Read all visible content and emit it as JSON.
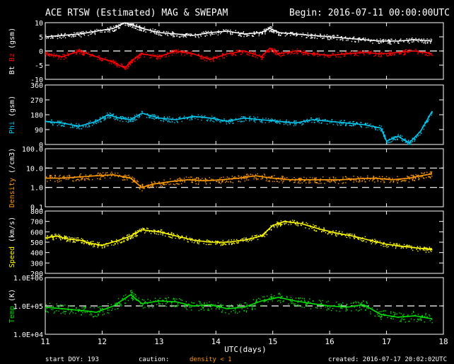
{
  "chart_data": {
    "type": "line",
    "title": "ACE RTSW (Estimated) MAG & SWEPAM",
    "begin_label": "Begin: 2016-07-11 00:00:00UTC",
    "xlabel": "UTC(days)",
    "x_ticks": [
      "11",
      "12",
      "13",
      "14",
      "15",
      "16",
      "17",
      "18"
    ],
    "xlim": [
      11,
      18
    ],
    "footer": {
      "start_doy": "start DOY: 193",
      "caution": "caution:",
      "density_note": "density < 1",
      "created": "created: 2016-07-17 20:02:02UTC"
    },
    "colors": {
      "bt": "#ffffff",
      "bz": "#ff0000",
      "phi": "#00c8f0",
      "density": "#ff9900",
      "speed": "#ffff00",
      "temp": "#00e000",
      "axes": "#ffffff"
    },
    "panels": [
      {
        "id": "mag",
        "ylabel_parts": [
          {
            "text": "Bt",
            "color": "#ffffff"
          },
          {
            "text": " Bz",
            "color": "#ff0000"
          },
          {
            "text": " (gsm)",
            "color": "#ffffff"
          }
        ],
        "ylim": [
          -10,
          10
        ],
        "scale": "linear",
        "yticks": [
          "10",
          "5",
          "0",
          "-5",
          "-10"
        ],
        "ytick_values": [
          10,
          5,
          0,
          -5,
          -10
        ],
        "ref_lines": [
          0
        ],
        "series": [
          {
            "name": "Bt",
            "color": "#ffffff",
            "x": [
              11.0,
              11.3,
              11.6,
              11.9,
              12.2,
              12.4,
              12.55,
              12.7,
              13.0,
              13.3,
              13.6,
              13.9,
              14.2,
              14.5,
              14.8,
              14.95,
              15.1,
              15.4,
              15.7,
              16.0,
              16.3,
              16.6,
              16.9,
              17.2,
              17.5,
              17.8
            ],
            "y": [
              5,
              5.5,
              6,
              7,
              8,
              10,
              9,
              8,
              6.5,
              6,
              5.5,
              6.5,
              7,
              6,
              6.5,
              8,
              6.5,
              6,
              5.5,
              5,
              4.5,
              4,
              3.5,
              3.5,
              4,
              3.5
            ]
          },
          {
            "name": "Bz",
            "color": "#ff0000",
            "x": [
              11.0,
              11.3,
              11.6,
              11.9,
              12.2,
              12.4,
              12.55,
              12.7,
              13.0,
              13.3,
              13.6,
              13.9,
              14.2,
              14.5,
              14.8,
              14.95,
              15.1,
              15.4,
              15.7,
              16.0,
              16.3,
              16.6,
              16.9,
              17.2,
              17.5,
              17.8
            ],
            "y": [
              -1,
              -2,
              0,
              -2,
              -4,
              -6,
              -3,
              -1,
              -2,
              0,
              -1,
              -3,
              -1,
              0,
              -2,
              1,
              -1,
              0,
              -1,
              -1.5,
              -1,
              -0.5,
              -1,
              -0.5,
              0,
              -1
            ]
          }
        ]
      },
      {
        "id": "phi",
        "ylabel_parts": [
          {
            "text": "Phi",
            "color": "#00c8f0"
          },
          {
            "text": " (gsm)",
            "color": "#ffffff"
          }
        ],
        "ylim": [
          0,
          360
        ],
        "scale": "linear",
        "yticks": [
          "360",
          "270",
          "180",
          "90",
          "0"
        ],
        "ytick_values": [
          360,
          270,
          180,
          90,
          0
        ],
        "ref_lines": [],
        "series": [
          {
            "name": "Phi",
            "color": "#00c8f0",
            "x": [
              11.0,
              11.3,
              11.6,
              11.9,
              12.1,
              12.3,
              12.5,
              12.7,
              13.0,
              13.3,
              13.6,
              13.9,
              14.2,
              14.5,
              14.8,
              15.1,
              15.4,
              15.7,
              16.0,
              16.3,
              16.6,
              16.9,
              17.0,
              17.2,
              17.4,
              17.6,
              17.8
            ],
            "y": [
              140,
              130,
              110,
              140,
              180,
              160,
              150,
              190,
              160,
              150,
              170,
              160,
              140,
              160,
              150,
              140,
              130,
              150,
              140,
              130,
              120,
              100,
              20,
              50,
              10,
              80,
              200
            ]
          }
        ]
      },
      {
        "id": "density",
        "ylabel_parts": [
          {
            "text": "Density",
            "color": "#ff9900"
          },
          {
            "text": " (/cm3)",
            "color": "#ffffff"
          }
        ],
        "ylim": [
          0.1,
          100
        ],
        "scale": "log",
        "yticks": [
          "100.0",
          "10.0",
          "1.0",
          "0.1"
        ],
        "ytick_values": [
          100,
          10,
          1,
          0.1
        ],
        "ref_lines": [
          10,
          1
        ],
        "series": [
          {
            "name": "Density",
            "color": "#ff9900",
            "x": [
              11.0,
              11.3,
              11.6,
              11.9,
              12.2,
              12.5,
              12.7,
              12.9,
              13.2,
              13.5,
              13.8,
              14.1,
              14.4,
              14.7,
              15.0,
              15.3,
              15.6,
              15.9,
              16.2,
              16.5,
              16.8,
              17.1,
              17.4,
              17.6,
              17.8
            ],
            "y": [
              3,
              3,
              3.5,
              4,
              4.5,
              3,
              1,
              1.5,
              2,
              2.5,
              2.2,
              2.5,
              3,
              4,
              3,
              2.5,
              2.5,
              2.5,
              2.5,
              2.8,
              3,
              2.5,
              3,
              4,
              5
            ]
          }
        ]
      },
      {
        "id": "speed",
        "ylabel_parts": [
          {
            "text": "Speed",
            "color": "#ffff00"
          },
          {
            "text": " (km/s)",
            "color": "#ffffff"
          }
        ],
        "ylim": [
          200,
          800
        ],
        "scale": "linear",
        "yticks": [
          "800",
          "700",
          "600",
          "500",
          "400",
          "300",
          "200"
        ],
        "ytick_values": [
          800,
          700,
          600,
          500,
          400,
          300,
          200
        ],
        "ref_lines": [],
        "series": [
          {
            "name": "Speed",
            "color": "#ffff00",
            "x": [
              11.0,
              11.2,
              11.4,
              11.6,
              11.8,
              12.0,
              12.3,
              12.5,
              12.7,
              13.0,
              13.3,
              13.6,
              13.9,
              14.2,
              14.5,
              14.8,
              15.0,
              15.2,
              15.5,
              15.8,
              16.1,
              16.4,
              16.7,
              17.0,
              17.3,
              17.6,
              17.8
            ],
            "y": [
              540,
              560,
              530,
              520,
              490,
              470,
              520,
              560,
              620,
              600,
              560,
              520,
              500,
              500,
              520,
              560,
              660,
              700,
              680,
              630,
              590,
              560,
              520,
              480,
              460,
              440,
              430
            ]
          }
        ]
      },
      {
        "id": "temp",
        "ylabel_parts": [
          {
            "text": "Temp",
            "color": "#00e000"
          },
          {
            "text": " (K)",
            "color": "#ffffff"
          }
        ],
        "ylim": [
          10000,
          1000000
        ],
        "scale": "log",
        "yticks": [
          "1.0E+06",
          "1.0E+05",
          "1.0E+04"
        ],
        "ytick_values": [
          1000000,
          100000,
          10000
        ],
        "ref_lines": [
          100000
        ],
        "series": [
          {
            "name": "Temp",
            "color": "#00e000",
            "x": [
              11.0,
              11.3,
              11.6,
              11.9,
              12.2,
              12.5,
              12.7,
              13.0,
              13.3,
              13.6,
              13.9,
              14.2,
              14.5,
              14.8,
              15.1,
              15.4,
              15.7,
              16.0,
              16.3,
              16.6,
              16.9,
              17.2,
              17.5,
              17.8
            ],
            "y": [
              90000,
              80000,
              70000,
              60000,
              100000,
              250000,
              120000,
              150000,
              140000,
              100000,
              110000,
              80000,
              90000,
              150000,
              200000,
              150000,
              120000,
              100000,
              90000,
              110000,
              50000,
              40000,
              45000,
              35000
            ]
          }
        ]
      }
    ]
  }
}
